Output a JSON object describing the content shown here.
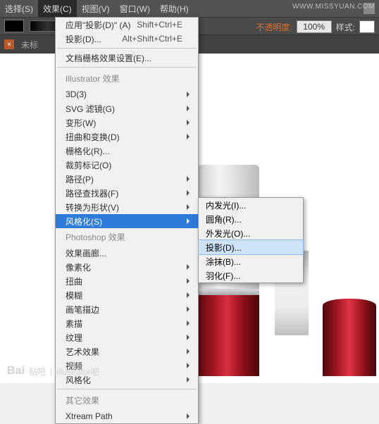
{
  "menubar": [
    "选择(S)",
    "效果(C)",
    "视图(V)",
    "窗口(W)",
    "帮助(H)"
  ],
  "menubar_active_index": 1,
  "urlwm": "WWW.MISSYUAN.COM",
  "optionbar": {
    "opacity_label": "不透明度:",
    "opacity_value": "100%",
    "style_label": "样式:"
  },
  "tabs": {
    "x": "×",
    "unnamed": "未标"
  },
  "menu": {
    "apply": {
      "label": "应用\"投影(D)\" (A)",
      "shortcut": "Shift+Ctrl+E"
    },
    "last": {
      "label": "投影(D)...",
      "shortcut": "Alt+Shift+Ctrl+E"
    },
    "rastersettings": "文档栅格效果设置(E)...",
    "hdr_ai": "Illustrator 效果",
    "ai": [
      "3D(3)",
      "SVG 滤镜(G)",
      "变形(W)",
      "扭曲和变换(D)",
      "栅格化(R)...",
      "裁剪标记(O)",
      "路径(P)",
      "路径查找器(F)",
      "转换为形状(V)",
      "风格化(S)"
    ],
    "hl_index": 9,
    "hdr_ps": "Photoshop 效果",
    "ps": [
      "效果画廊...",
      "像素化",
      "扭曲",
      "模糊",
      "画笔描边",
      "素描",
      "纹理",
      "艺术效果",
      "视频",
      "风格化"
    ],
    "hdr_other": "其它效果",
    "other": [
      "Xtream Path"
    ]
  },
  "submenu": {
    "items": [
      "内发光(I)...",
      "圆角(R)...",
      "外发光(O)...",
      "投影(D)...",
      "涂抹(B)...",
      "羽化(F)..."
    ],
    "hover_index": 3
  },
  "watermark": {
    "brand": "Bai",
    "brand2": "贴吧",
    "text": "illustrator吧"
  }
}
